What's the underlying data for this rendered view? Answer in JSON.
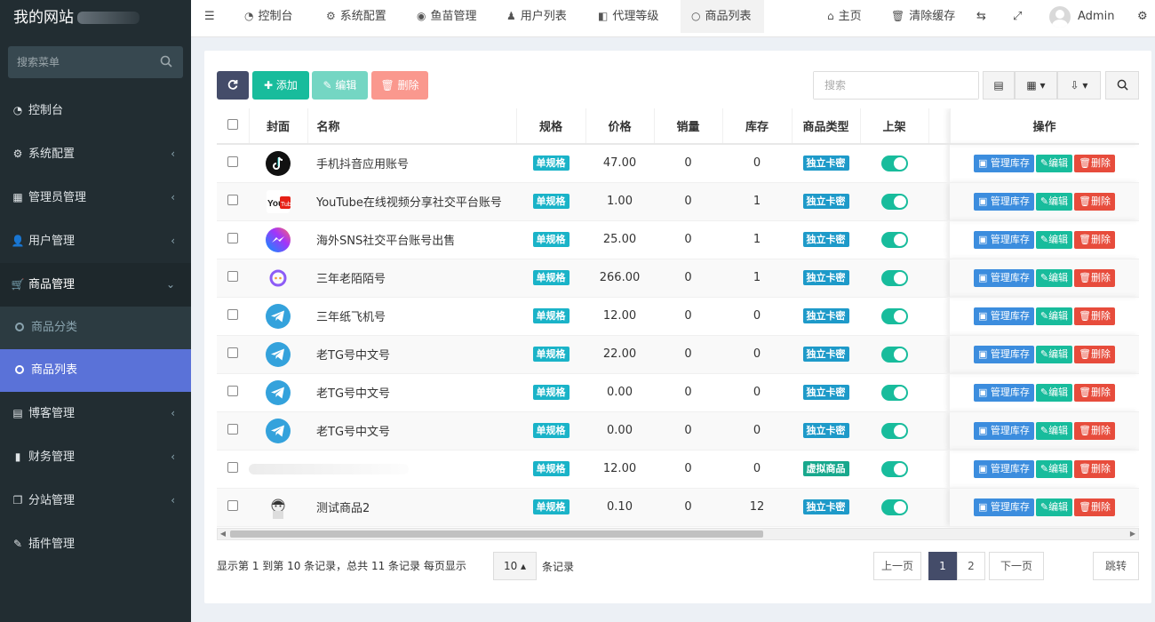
{
  "sidebar": {
    "logo": "我的网站",
    "search_placeholder": "搜索菜单",
    "items": [
      {
        "label": "控制台",
        "icon": "dashboard-icon",
        "glyph": "◔",
        "chevron": ""
      },
      {
        "label": "系统配置",
        "icon": "cogs-icon",
        "glyph": "⚙",
        "chevron": "‹"
      },
      {
        "label": "管理员管理",
        "icon": "windows-icon",
        "glyph": "▦",
        "chevron": "‹"
      },
      {
        "label": "用户管理",
        "icon": "user-icon",
        "glyph": "👤",
        "chevron": "‹"
      },
      {
        "label": "商品管理",
        "icon": "cart-icon",
        "glyph": "🛒",
        "chevron": "⌄"
      },
      {
        "label": "博客管理",
        "icon": "book-icon",
        "glyph": "▤",
        "chevron": "‹"
      },
      {
        "label": "财务管理",
        "icon": "bookmark-icon",
        "glyph": "▮",
        "chevron": "‹"
      },
      {
        "label": "分站管理",
        "icon": "clone-icon",
        "glyph": "❐",
        "chevron": "‹"
      },
      {
        "label": "插件管理",
        "icon": "wrench-icon",
        "glyph": "✎",
        "chevron": ""
      }
    ],
    "sub_items": [
      {
        "label": "商品分类"
      },
      {
        "label": "商品列表"
      }
    ]
  },
  "topnav": {
    "tabs": [
      {
        "label": "控制台",
        "glyph": "◔"
      },
      {
        "label": "系统配置",
        "glyph": "⚙"
      },
      {
        "label": "鱼苗管理",
        "glyph": "◉"
      },
      {
        "label": "用户列表",
        "glyph": "♟"
      },
      {
        "label": "代理等级",
        "glyph": "◧"
      },
      {
        "label": "商品列表",
        "glyph": "○"
      }
    ],
    "home": "主页",
    "clear_cache": "清除缓存",
    "user": "Admin"
  },
  "toolbar": {
    "add": "添加",
    "edit": "编辑",
    "delete": "删除",
    "search_placeholder": "搜索"
  },
  "table": {
    "columns": [
      "封面",
      "名称",
      "规格",
      "价格",
      "销量",
      "库存",
      "商品类型",
      "上架",
      "操作"
    ],
    "actions": {
      "stock": "管理库存",
      "edit": "编辑",
      "delete": "删除"
    },
    "rows": [
      {
        "cover": "tiktok",
        "name": "手机抖音应用账号",
        "spec": "单规格",
        "price": "47.00",
        "sales": "0",
        "stock": "0",
        "type": "独立卡密"
      },
      {
        "cover": "youtube",
        "name": "YouTube在线视频分享社交平台账号",
        "spec": "单规格",
        "price": "1.00",
        "sales": "0",
        "stock": "1",
        "type": "独立卡密"
      },
      {
        "cover": "messenger",
        "name": "海外SNS社交平台账号出售",
        "spec": "单规格",
        "price": "25.00",
        "sales": "0",
        "stock": "1",
        "type": "独立卡密"
      },
      {
        "cover": "momo",
        "name": "三年老陌陌号",
        "spec": "单规格",
        "price": "266.00",
        "sales": "0",
        "stock": "1",
        "type": "独立卡密"
      },
      {
        "cover": "telegram",
        "name": "三年纸飞机号",
        "spec": "单规格",
        "price": "12.00",
        "sales": "0",
        "stock": "0",
        "type": "独立卡密"
      },
      {
        "cover": "telegram",
        "name": "老TG号中文号",
        "spec": "单规格",
        "price": "22.00",
        "sales": "0",
        "stock": "0",
        "type": "独立卡密"
      },
      {
        "cover": "telegram",
        "name": "老TG号中文号",
        "spec": "单规格",
        "price": "0.00",
        "sales": "0",
        "stock": "0",
        "type": "独立卡密"
      },
      {
        "cover": "telegram",
        "name": "老TG号中文号",
        "spec": "单规格",
        "price": "0.00",
        "sales": "0",
        "stock": "0",
        "type": "独立卡密"
      },
      {
        "cover": "blank",
        "name": "",
        "spec": "单规格",
        "price": "12.00",
        "sales": "0",
        "stock": "0",
        "type": "虚拟商品"
      },
      {
        "cover": "avatar",
        "name": "测试商品2",
        "spec": "单规格",
        "price": "0.10",
        "sales": "0",
        "stock": "12",
        "type": "独立卡密"
      }
    ]
  },
  "footer": {
    "summary": "显示第 1 到第 10 条记录，总共 11 条记录 每页显示",
    "page_size": "10",
    "suffix": "条记录",
    "prev": "上一页",
    "pages": [
      "1",
      "2"
    ],
    "next": "下一页",
    "jump": "跳转"
  },
  "colors": {
    "sidebar": "#222d32",
    "active_item": "#5a72d8",
    "primary": "#18bc9c",
    "danger": "#e74c3c",
    "info": "#3c8dde"
  }
}
